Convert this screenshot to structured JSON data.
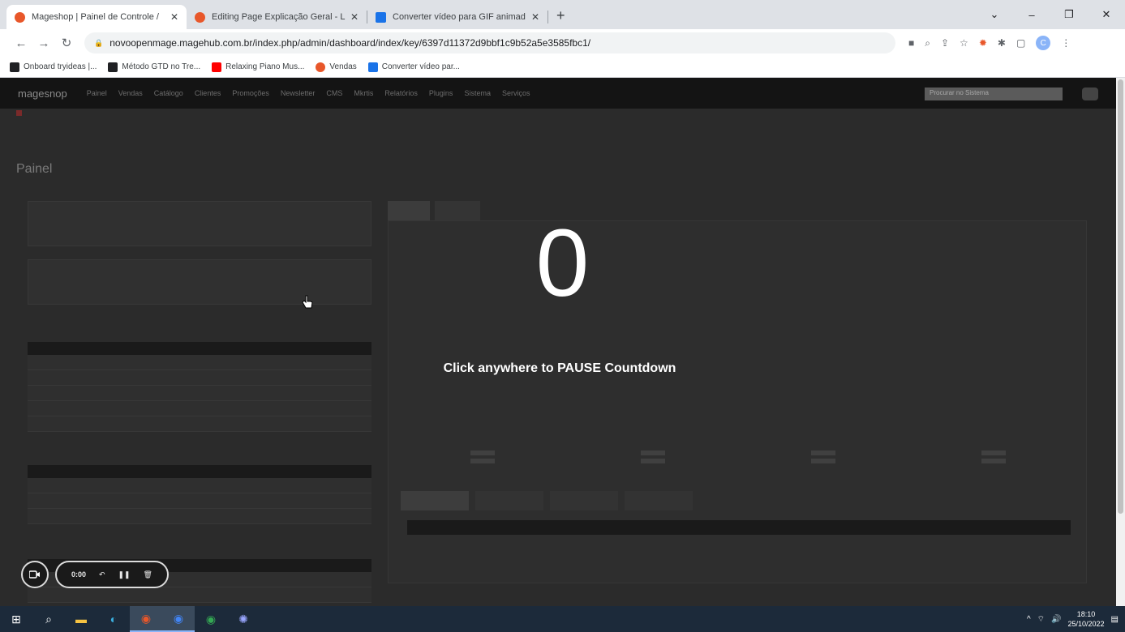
{
  "browser": {
    "tabs": [
      {
        "title": "Mageshop | Painel de Controle /",
        "favicon_color": "#e8572a",
        "active": true
      },
      {
        "title": "Editing Page Explicação Geral - L",
        "favicon_color": "#e8572a",
        "active": false
      },
      {
        "title": "Converter vídeo para GIF animad",
        "favicon_color": "#1a73e8",
        "active": false
      }
    ],
    "new_tab_symbol": "+",
    "window_controls": {
      "minimize": "–",
      "maximize": "❐",
      "close": "✕",
      "tabsearch": "⌄"
    },
    "url": "novoopenmage.magehub.com.br/index.php/admin/dashboard/index/key/6397d11372d9bbf1c9b52a5e3585fbc1/",
    "bookmarks": [
      {
        "label": "Onboard tryideas |...",
        "color": "#202124"
      },
      {
        "label": "Método GTD no Tre...",
        "color": "#202124"
      },
      {
        "label": "Relaxing Piano Mus...",
        "color": "#ff0000"
      },
      {
        "label": "Vendas",
        "color": "#e8572a"
      },
      {
        "label": "Converter vídeo par...",
        "color": "#1a73e8"
      }
    ],
    "profile_initial": "C"
  },
  "admin": {
    "logo": "magesnop",
    "nav_items": [
      "Painel",
      "Vendas",
      "Catálogo",
      "Clientes",
      "Promoções",
      "Newsletter",
      "CMS",
      "Mkrtis",
      "Relatórios",
      "Plugins",
      "Sistema",
      "Serviços"
    ],
    "search_placeholder": "Procurar no Sistema",
    "page_title": "Painel"
  },
  "overlay": {
    "countdown": "0",
    "hint": "Click anywhere to PAUSE Countdown",
    "recorder_time": "0:00"
  },
  "taskbar": {
    "time": "18:10",
    "date": "25/10/2022"
  }
}
